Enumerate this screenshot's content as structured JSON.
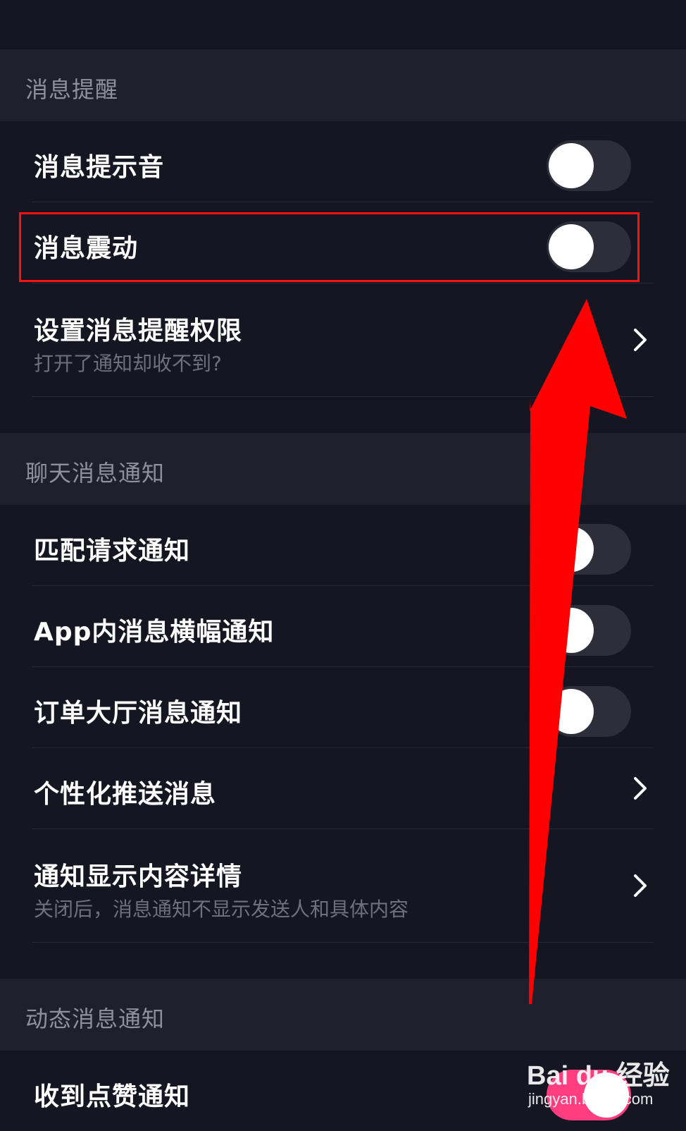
{
  "sections": [
    {
      "title": "消息提醒"
    },
    {
      "title": "聊天消息通知"
    },
    {
      "title": "动态消息通知"
    }
  ],
  "rows": {
    "sound": {
      "title": "消息提示音",
      "state": "off"
    },
    "vibrate": {
      "title": "消息震动",
      "state": "off"
    },
    "permission": {
      "title": "设置消息提醒权限",
      "subtitle": "打开了通知却收不到?"
    },
    "match": {
      "title": "匹配请求通知",
      "state": "off"
    },
    "banner": {
      "title": "App内消息横幅通知",
      "state": "off"
    },
    "order": {
      "title": "订单大厅消息通知",
      "state": "off"
    },
    "push": {
      "title": "个性化推送消息"
    },
    "detail": {
      "title": "通知显示内容详情",
      "subtitle": "关闭后，消息通知不显示发送人和具体内容"
    },
    "like": {
      "title": "收到点赞通知",
      "state": "on"
    }
  },
  "watermark": {
    "logo": "Bai du 经验",
    "url": "jingyan.baidu.com"
  },
  "colors": {
    "background": "#161622",
    "section_header_bg": "#20202d",
    "toggle_off": "#2e2e3a",
    "toggle_on": "#ff3d7f",
    "highlight": "#ff1111",
    "arrow": "#ff0000"
  }
}
